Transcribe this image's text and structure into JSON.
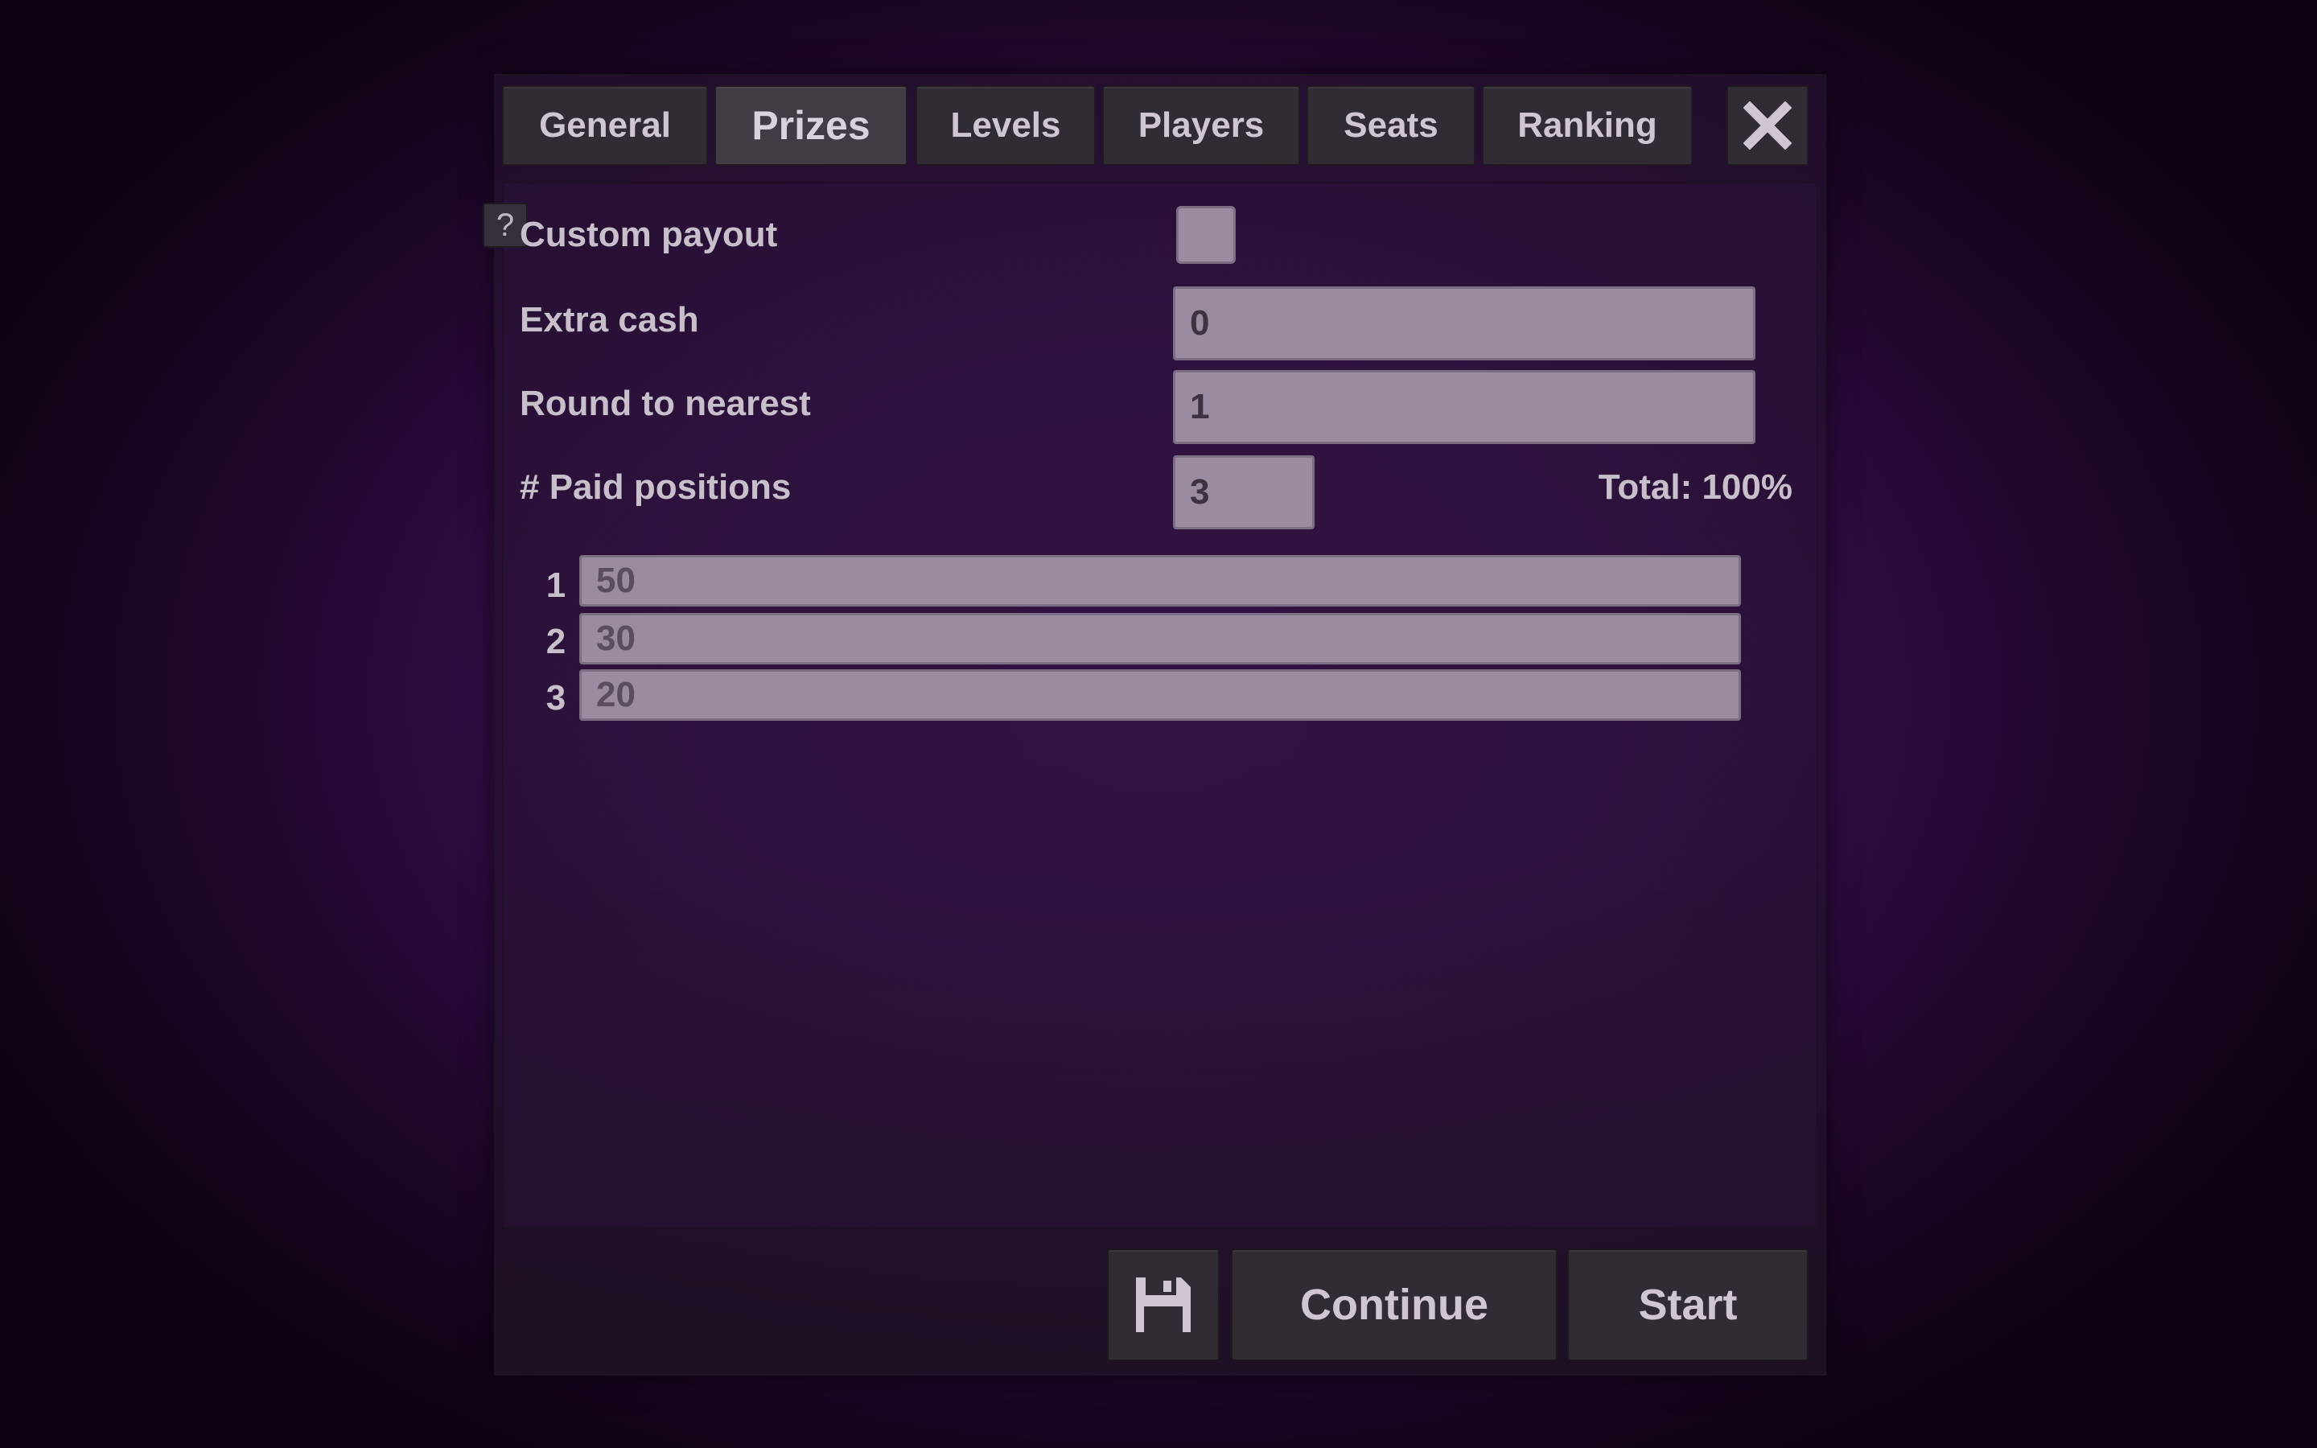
{
  "tabs": [
    {
      "label": "General",
      "active": false
    },
    {
      "label": "Prizes",
      "active": true
    },
    {
      "label": "Levels",
      "active": false
    },
    {
      "label": "Players",
      "active": false
    },
    {
      "label": "Seats",
      "active": false
    },
    {
      "label": "Ranking",
      "active": false
    }
  ],
  "help_label": "?",
  "form": {
    "custom_payout_label": "Custom payout",
    "custom_payout_checked": false,
    "extra_cash_label": "Extra cash",
    "extra_cash_value": "0",
    "round_label": "Round to nearest",
    "round_value": "1",
    "paid_positions_label": "# Paid positions",
    "paid_positions_value": "3",
    "total_text": "Total: 100%"
  },
  "prizes": [
    {
      "position": "1",
      "value": "50"
    },
    {
      "position": "2",
      "value": "30"
    },
    {
      "position": "3",
      "value": "20"
    }
  ],
  "footer": {
    "save_icon": "floppy-disk-icon",
    "continue_label": "Continue",
    "start_label": "Start"
  },
  "colors": {
    "background": "#3a0f55",
    "field": "#9a8ba0",
    "button": "#312b34",
    "text": "#c7bfc9"
  }
}
